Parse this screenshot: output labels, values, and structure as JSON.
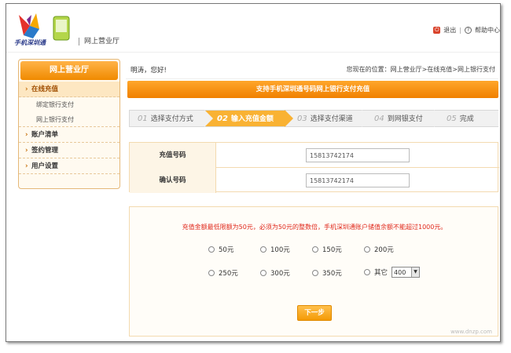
{
  "header": {
    "logo_text": "手机深圳通",
    "site_name": "网上营业厅",
    "logout_label": "退出",
    "help_label": "帮助中心"
  },
  "sidebar": {
    "title": "网上营业厅",
    "items": [
      {
        "label": "在线充值",
        "active": true,
        "subs": [
          "绑定银行支付",
          "网上银行支付"
        ]
      },
      {
        "label": "账户清单"
      },
      {
        "label": "签约管理"
      },
      {
        "label": "用户设置"
      }
    ]
  },
  "greeting": "明涛，您好!",
  "location": "您现在的位置：网上营业厅>在线充值>网上银行支付",
  "banner": "支持手机深圳通号码网上银行支付充值",
  "steps": [
    {
      "num": "01",
      "label": "选择支付方式"
    },
    {
      "num": "02",
      "label": "输入充值金额"
    },
    {
      "num": "03",
      "label": "选择支付渠道"
    },
    {
      "num": "04",
      "label": "到网银支付"
    },
    {
      "num": "05",
      "label": "完成"
    }
  ],
  "form": {
    "recharge_label": "充值号码",
    "recharge_value": "15813742174",
    "confirm_label": "确认号码",
    "confirm_value": "15813742174"
  },
  "amounts": {
    "notice": "充值金额最低限额为50元，必须为50元的整数倍，手机深圳通账户储值余额不能超过1000元。",
    "options": [
      "50元",
      "100元",
      "150元",
      "200元",
      "250元",
      "300元",
      "350元"
    ],
    "other_label": "其它",
    "other_value": "400"
  },
  "next_button": "下一步",
  "watermark": "www.dnzp.com"
}
